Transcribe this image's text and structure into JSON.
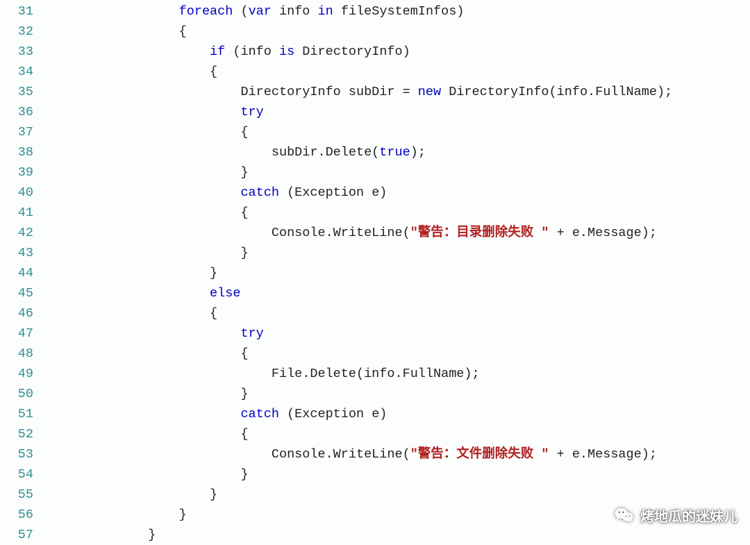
{
  "colors": {
    "line_number": "#2f8f8f",
    "keyword": "#0000c0",
    "string": "#b02020",
    "text": "#222222",
    "background": "#fcfdfd"
  },
  "watermark": {
    "text": "烤地瓜的迷妹儿",
    "icon": "wechat-icon"
  },
  "code": [
    {
      "n": 31,
      "indent": 16,
      "tokens": [
        {
          "t": "kw",
          "v": "foreach"
        },
        {
          "t": "txt",
          "v": " ("
        },
        {
          "t": "kw",
          "v": "var"
        },
        {
          "t": "txt",
          "v": " info "
        },
        {
          "t": "kw",
          "v": "in"
        },
        {
          "t": "txt",
          "v": " fileSystemInfos)"
        }
      ]
    },
    {
      "n": 32,
      "indent": 16,
      "tokens": [
        {
          "t": "txt",
          "v": "{"
        }
      ]
    },
    {
      "n": 33,
      "indent": 20,
      "tokens": [
        {
          "t": "kw",
          "v": "if"
        },
        {
          "t": "txt",
          "v": " (info "
        },
        {
          "t": "kw",
          "v": "is"
        },
        {
          "t": "txt",
          "v": " DirectoryInfo)"
        }
      ]
    },
    {
      "n": 34,
      "indent": 20,
      "tokens": [
        {
          "t": "txt",
          "v": "{"
        }
      ]
    },
    {
      "n": 35,
      "indent": 24,
      "tokens": [
        {
          "t": "txt",
          "v": "DirectoryInfo subDir = "
        },
        {
          "t": "kw",
          "v": "new"
        },
        {
          "t": "txt",
          "v": " DirectoryInfo(info.FullName);"
        }
      ]
    },
    {
      "n": 36,
      "indent": 24,
      "tokens": [
        {
          "t": "kw",
          "v": "try"
        }
      ]
    },
    {
      "n": 37,
      "indent": 24,
      "tokens": [
        {
          "t": "txt",
          "v": "{"
        }
      ]
    },
    {
      "n": 38,
      "indent": 28,
      "tokens": [
        {
          "t": "txt",
          "v": "subDir.Delete("
        },
        {
          "t": "kw",
          "v": "true"
        },
        {
          "t": "txt",
          "v": ");"
        }
      ]
    },
    {
      "n": 39,
      "indent": 24,
      "tokens": [
        {
          "t": "txt",
          "v": "}"
        }
      ]
    },
    {
      "n": 40,
      "indent": 24,
      "tokens": [
        {
          "t": "kw",
          "v": "catch"
        },
        {
          "t": "txt",
          "v": " (Exception e)"
        }
      ]
    },
    {
      "n": 41,
      "indent": 24,
      "tokens": [
        {
          "t": "txt",
          "v": "{"
        }
      ]
    },
    {
      "n": 42,
      "indent": 28,
      "tokens": [
        {
          "t": "txt",
          "v": "Console.WriteLine("
        },
        {
          "t": "str",
          "v": "\"警告：目录删除失败 \""
        },
        {
          "t": "txt",
          "v": " + e.Message);"
        }
      ]
    },
    {
      "n": 43,
      "indent": 24,
      "tokens": [
        {
          "t": "txt",
          "v": "}"
        }
      ]
    },
    {
      "n": 44,
      "indent": 20,
      "tokens": [
        {
          "t": "txt",
          "v": "}"
        }
      ]
    },
    {
      "n": 45,
      "indent": 20,
      "tokens": [
        {
          "t": "kw",
          "v": "else"
        }
      ]
    },
    {
      "n": 46,
      "indent": 20,
      "tokens": [
        {
          "t": "txt",
          "v": "{"
        }
      ]
    },
    {
      "n": 47,
      "indent": 24,
      "tokens": [
        {
          "t": "kw",
          "v": "try"
        }
      ]
    },
    {
      "n": 48,
      "indent": 24,
      "tokens": [
        {
          "t": "txt",
          "v": "{"
        }
      ]
    },
    {
      "n": 49,
      "indent": 28,
      "tokens": [
        {
          "t": "txt",
          "v": "File.Delete(info.FullName);"
        }
      ]
    },
    {
      "n": 50,
      "indent": 24,
      "tokens": [
        {
          "t": "txt",
          "v": "}"
        }
      ]
    },
    {
      "n": 51,
      "indent": 24,
      "tokens": [
        {
          "t": "kw",
          "v": "catch"
        },
        {
          "t": "txt",
          "v": " (Exception e)"
        }
      ]
    },
    {
      "n": 52,
      "indent": 24,
      "tokens": [
        {
          "t": "txt",
          "v": "{"
        }
      ]
    },
    {
      "n": 53,
      "indent": 28,
      "tokens": [
        {
          "t": "txt",
          "v": "Console.WriteLine("
        },
        {
          "t": "str",
          "v": "\"警告：文件删除失败 \""
        },
        {
          "t": "txt",
          "v": " + e.Message);"
        }
      ]
    },
    {
      "n": 54,
      "indent": 24,
      "tokens": [
        {
          "t": "txt",
          "v": "}"
        }
      ]
    },
    {
      "n": 55,
      "indent": 20,
      "tokens": [
        {
          "t": "txt",
          "v": "}"
        }
      ]
    },
    {
      "n": 56,
      "indent": 16,
      "tokens": [
        {
          "t": "txt",
          "v": "}"
        }
      ]
    },
    {
      "n": 57,
      "indent": 12,
      "tokens": [
        {
          "t": "txt",
          "v": "}"
        }
      ]
    }
  ]
}
